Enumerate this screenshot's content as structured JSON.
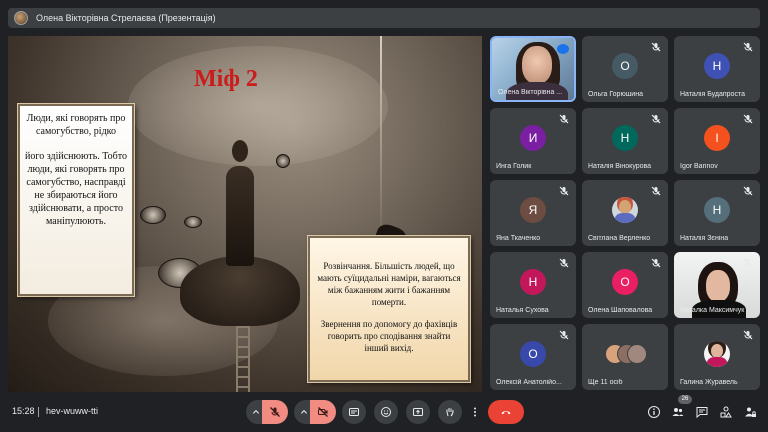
{
  "presenter_bar": {
    "title": "Олена Вікторівна Стрелаєва (Презентація)"
  },
  "slide": {
    "title": "Міф 2",
    "left_card": {
      "line1": "Люди, які говорять про самогубство, рідко",
      "line2": "його здійснюють. Тобто люди, які говорять про самогубство, насправді не збираються його здійснювати, а просто маніпулюють."
    },
    "right_card": {
      "para1": "Розвінчання. Більшість людей, що мають суїцидальні наміри, вагаються між бажанням жити і бажанням померти.",
      "para2": "Звернення по допомогу до фахівців говорить про сподівання знайти інший вихід."
    }
  },
  "participants": [
    {
      "name": "Олена Вікторівна ...",
      "kind": "video-self",
      "active": true
    },
    {
      "name": "Ольга Горюшина",
      "kind": "letter",
      "letter": "О",
      "color": "#455a64"
    },
    {
      "name": "Наталія Будапроста",
      "kind": "letter",
      "letter": "Н",
      "color": "#3f51b5"
    },
    {
      "name": "Инга Голик",
      "kind": "letter",
      "letter": "И",
      "color": "#7b1fa2"
    },
    {
      "name": "Наталія Вінокурова",
      "kind": "letter",
      "letter": "Н",
      "color": "#00695c"
    },
    {
      "name": "Igor Barinov",
      "kind": "letter",
      "letter": "I",
      "color": "#f4511e"
    },
    {
      "name": "Яна Ткаченко",
      "kind": "letter",
      "letter": "Я",
      "color": "#6d4c41"
    },
    {
      "name": "Світлана Верленко",
      "kind": "photo"
    },
    {
      "name": "Наталія Зєніна",
      "kind": "letter",
      "letter": "Н",
      "color": "#546e7a"
    },
    {
      "name": "Наталья Сухова",
      "kind": "letter",
      "letter": "Н",
      "color": "#c2185b"
    },
    {
      "name": "Олена Шаповалова",
      "kind": "letter",
      "letter": "О",
      "color": "#e91e63"
    },
    {
      "name": "Наталка Максимчук",
      "kind": "video-nat"
    },
    {
      "name": "Олексій Анатолійо...",
      "kind": "letter",
      "letter": "О",
      "color": "#3949ab"
    },
    {
      "name": "Ще 11 осіб",
      "kind": "more"
    },
    {
      "name": "Галина Журавель",
      "kind": "photo2"
    }
  ],
  "bottom_bar": {
    "time": "15:28",
    "meeting_code": "hev-wuww-tti",
    "participants_count": "26"
  },
  "colors": {
    "end_call": "#ea4335",
    "accent": "#8ab4f8",
    "tile_bg": "#3c4043"
  },
  "icons": [
    "mic-off-icon",
    "camera-off-icon",
    "captions-icon",
    "emoji-icon",
    "present-icon",
    "raise-hand-icon",
    "more-icon",
    "end-call-icon",
    "info-icon",
    "people-icon",
    "chat-icon",
    "activities-icon"
  ]
}
